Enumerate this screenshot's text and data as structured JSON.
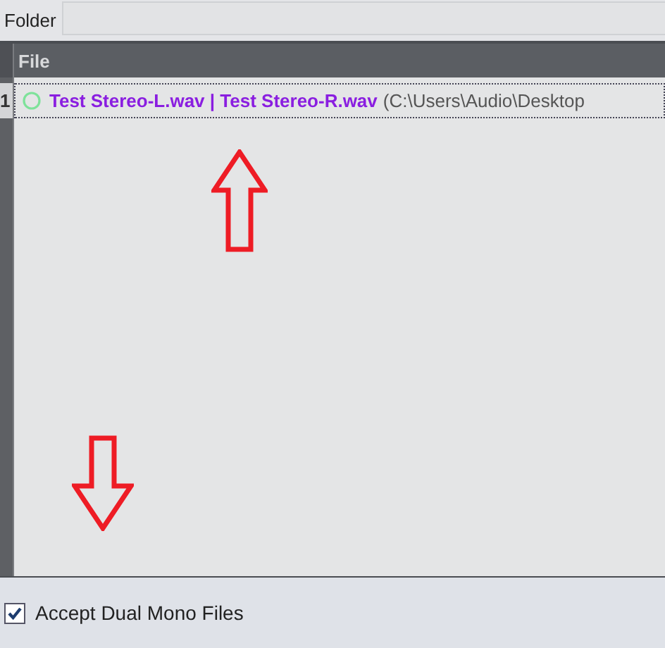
{
  "folder": {
    "label": "Folder"
  },
  "table": {
    "columns": [
      "File"
    ],
    "rows": [
      {
        "number": "1",
        "focused": true,
        "name": "Test Stereo-L.wav | Test Stereo-R.wav",
        "path": "(C:\\Users\\Audio\\Desktop"
      }
    ]
  },
  "options": [
    {
      "label": "Accept Dual Mono Files",
      "checked": true
    }
  ]
}
